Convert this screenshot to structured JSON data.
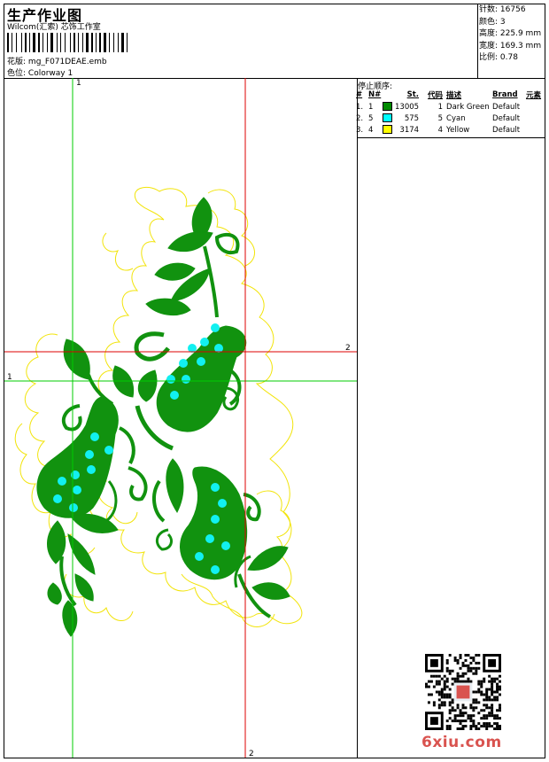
{
  "header": {
    "title": "生产作业图",
    "company": "Wilcom(汇索) 芯饰工作室",
    "design_label": "花版:",
    "design_file": "mg_F071DEAE.emb",
    "colorway_label": "色位:",
    "colorway": "Colorway 1"
  },
  "stats": [
    {
      "label": "针数:",
      "value": "16756"
    },
    {
      "label": "颜色:",
      "value": "3"
    },
    {
      "label": "高度:",
      "value": "225.9 mm"
    },
    {
      "label": "宽度:",
      "value": "169.3 mm"
    },
    {
      "label": "比例:",
      "value": "0.78"
    }
  ],
  "stop_sequence": {
    "title": "停止顺序:",
    "headers": {
      "hash": "#",
      "n": "N#",
      "st": "St.",
      "code": "代码",
      "desc": "描述",
      "brand": "Brand",
      "element": "元素"
    },
    "rows": [
      {
        "idx": "1.",
        "n": "1",
        "color": "#008a00",
        "st": "13005",
        "code": "1",
        "desc": "Dark Green",
        "brand": "Default"
      },
      {
        "idx": "2.",
        "n": "5",
        "color": "#00ffff",
        "st": "575",
        "code": "5",
        "desc": "Cyan",
        "brand": "Default"
      },
      {
        "idx": "3.",
        "n": "4",
        "color": "#ffff00",
        "st": "3174",
        "code": "4",
        "desc": "Yellow",
        "brand": "Default"
      }
    ]
  },
  "design": {
    "axis_labels": {
      "green_v": "1",
      "green_h": "1",
      "red_h": "2",
      "red_v": "2"
    },
    "colors": {
      "green": "#11920f",
      "cyan": "#12f0f0",
      "yellow": "#f2e40a",
      "guide_green": "#00cc00",
      "guide_red": "#dd0000"
    }
  },
  "watermark": "6xiu.com"
}
